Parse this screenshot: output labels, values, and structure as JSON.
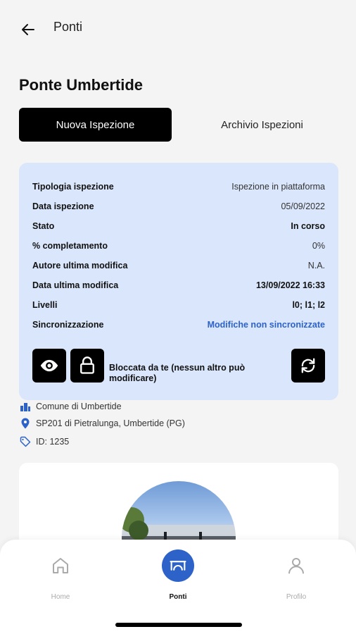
{
  "header": {
    "title": "Ponti"
  },
  "bridge": {
    "name": "Ponte Umbertide"
  },
  "tabs": [
    {
      "label": "Nuova Ispezione",
      "active": true
    },
    {
      "label": "Archivio Ispezioni",
      "active": false
    }
  ],
  "inspection": {
    "rows": [
      {
        "label": "Tipologia ispezione",
        "value": "Ispezione in piattaforma"
      },
      {
        "label": "Data ispezione",
        "value": "05/09/2022"
      },
      {
        "label": "Stato",
        "value": "In corso"
      },
      {
        "label": "% completamento",
        "value": "0%"
      },
      {
        "label": "Autore ultima modifica",
        "value": "N.A."
      },
      {
        "label": "Data ultima modifica",
        "value": "13/09/2022 16:33"
      },
      {
        "label": "Livelli",
        "value": "l0; l1; l2"
      },
      {
        "label": "Sincronizzazione",
        "value": "Modifiche non sincronizzate"
      }
    ],
    "lock_text": "Bloccata da te (nessun altro può modificare)"
  },
  "meta": {
    "municipality": "Comune di Umbertide",
    "location": "SP201  di Pietralunga, Umbertide (PG)",
    "id": "ID: 1235"
  },
  "nav": [
    {
      "label": "Home",
      "icon": "home-icon",
      "active": false
    },
    {
      "label": "Ponti",
      "icon": "bridge-icon",
      "active": true
    },
    {
      "label": "Profilo",
      "icon": "user-icon",
      "active": false
    }
  ],
  "colors": {
    "accent": "#2d62c9",
    "card_bg": "#d9e6fb",
    "nav_active_bg": "#2d62c9"
  }
}
